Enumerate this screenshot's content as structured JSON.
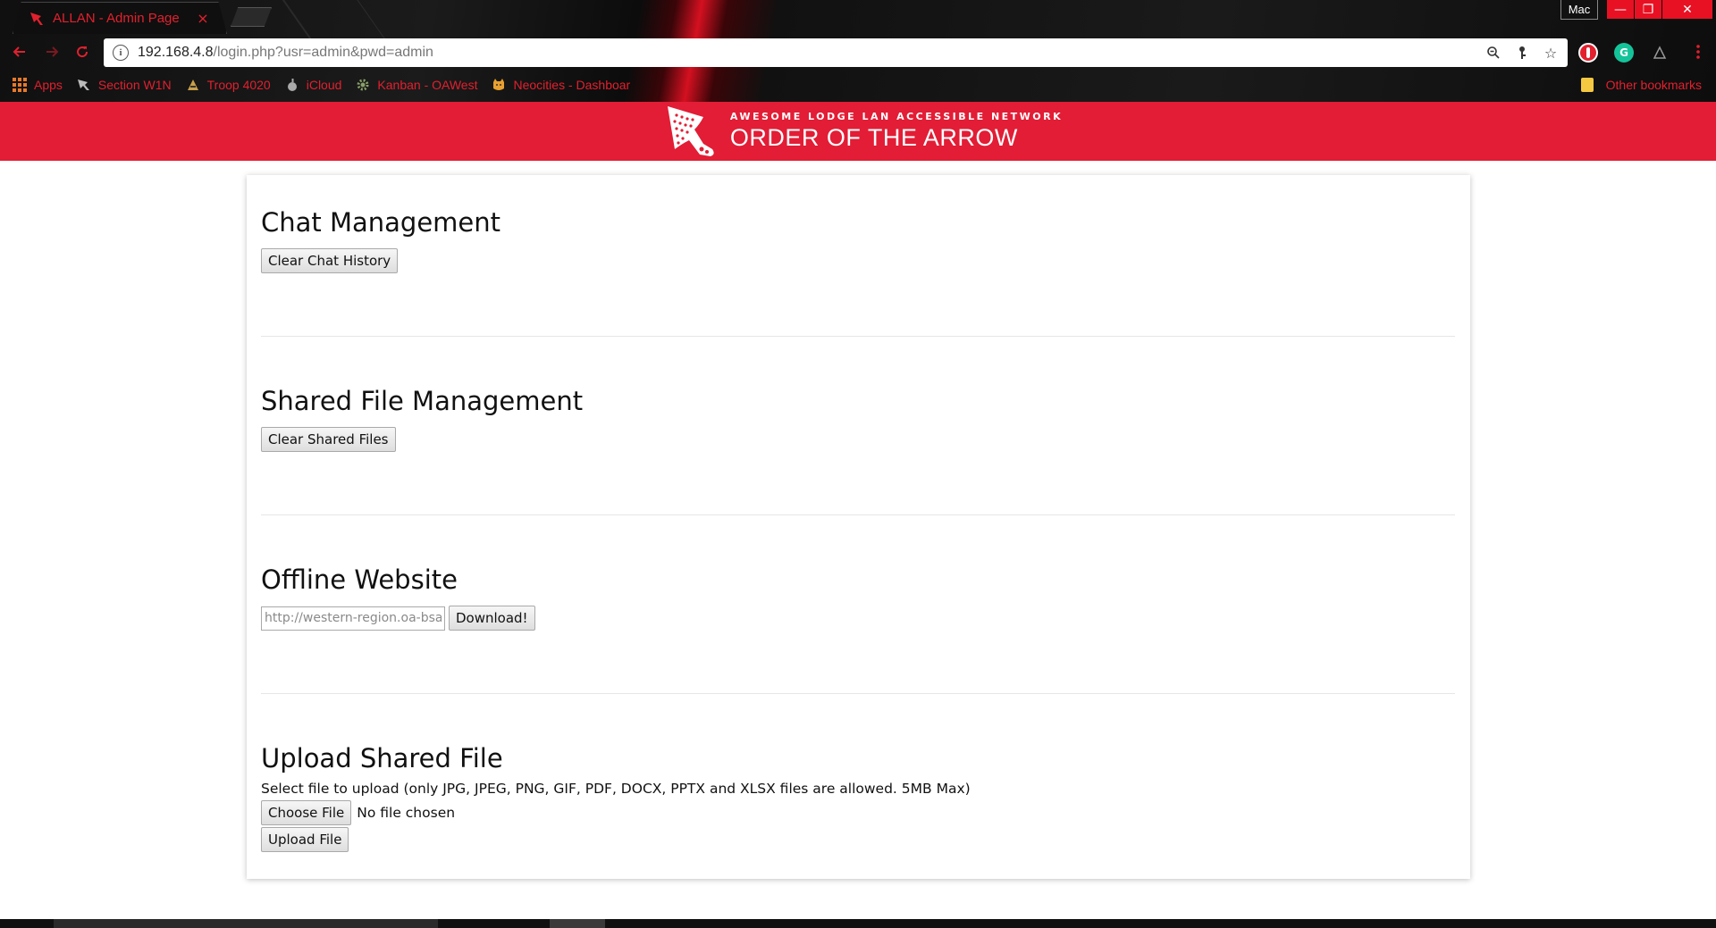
{
  "browser": {
    "tab_title": "ALLAN - Admin Page",
    "tab_close": "×",
    "profile": "Mac",
    "window_controls": {
      "minimize": "—",
      "restore": "❐",
      "close": "✕"
    },
    "url_host": "192.168.4.8",
    "url_path": "/login.php?usr=admin&pwd=admin",
    "bookmarks": [
      {
        "label": "Apps",
        "icon": "apps-grid-icon"
      },
      {
        "label": "Section W1N",
        "icon": "arrowhead-icon"
      },
      {
        "label": "Troop 4020",
        "icon": "scout-icon"
      },
      {
        "label": "iCloud",
        "icon": "apple-icon"
      },
      {
        "label": "Kanban - OAWest",
        "icon": "gear-icon"
      },
      {
        "label": "Neocities - Dashboar",
        "icon": "cat-icon"
      }
    ],
    "other_bookmarks": "Other bookmarks",
    "accent_color": "#e2202e"
  },
  "banner": {
    "subtitle": "AWESOME LODGE LAN ACCESSIBLE NETWORK",
    "title": "ORDER OF THE ARROW",
    "background": "#e21d35"
  },
  "sections": {
    "chat": {
      "heading": "Chat Management",
      "button": "Clear Chat History"
    },
    "shared": {
      "heading": "Shared File Management",
      "button": "Clear Shared Files"
    },
    "offline": {
      "heading": "Offline Website",
      "placeholder": "http://western-region.oa-bsa.org",
      "button": "Download!"
    },
    "upload": {
      "heading": "Upload Shared File",
      "help": "Select file to upload (only JPG, JPEG, PNG, GIF, PDF, DOCX, PPTX and XLSX files are allowed. 5MB Max)",
      "choose_button": "Choose File",
      "no_file": "No file chosen",
      "upload_button": "Upload File"
    }
  }
}
